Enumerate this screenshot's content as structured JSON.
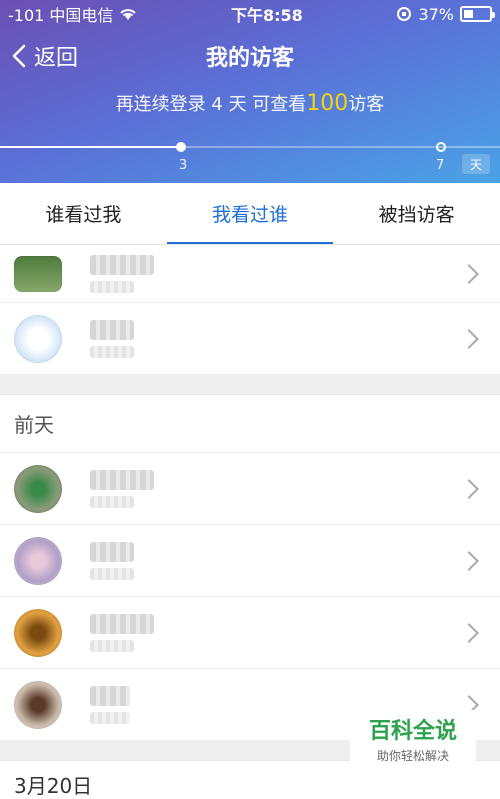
{
  "status_bar": {
    "carrier": "-101 中国电信",
    "time": "下午8:58",
    "battery_percent": "37%",
    "battery_level": 0.37,
    "icons": [
      "wifi-icon",
      "rotation-lock-icon",
      "battery-icon"
    ]
  },
  "nav": {
    "back_label": "返回",
    "title": "我的访客"
  },
  "login_note": {
    "prefix": "再连续登录 4 天 可查看",
    "highlight": "100",
    "suffix": "访客"
  },
  "progress": {
    "current_tick": "3",
    "max_tick": "7",
    "unit_badge": "天",
    "fraction": 0.36
  },
  "tabs": [
    {
      "label": "谁看过我"
    },
    {
      "label": "我看过谁"
    },
    {
      "label": "被挡访客"
    }
  ],
  "sections": [
    {
      "title": "前天"
    }
  ],
  "colors": {
    "accent_blue": "#1e6fd9",
    "highlight_yellow": "#ffd700",
    "watermark_green": "#2ca24d"
  },
  "watermark": {
    "title": "百科全说",
    "subtitle": "助你轻松解决"
  },
  "bottom_peek": "3月20日"
}
